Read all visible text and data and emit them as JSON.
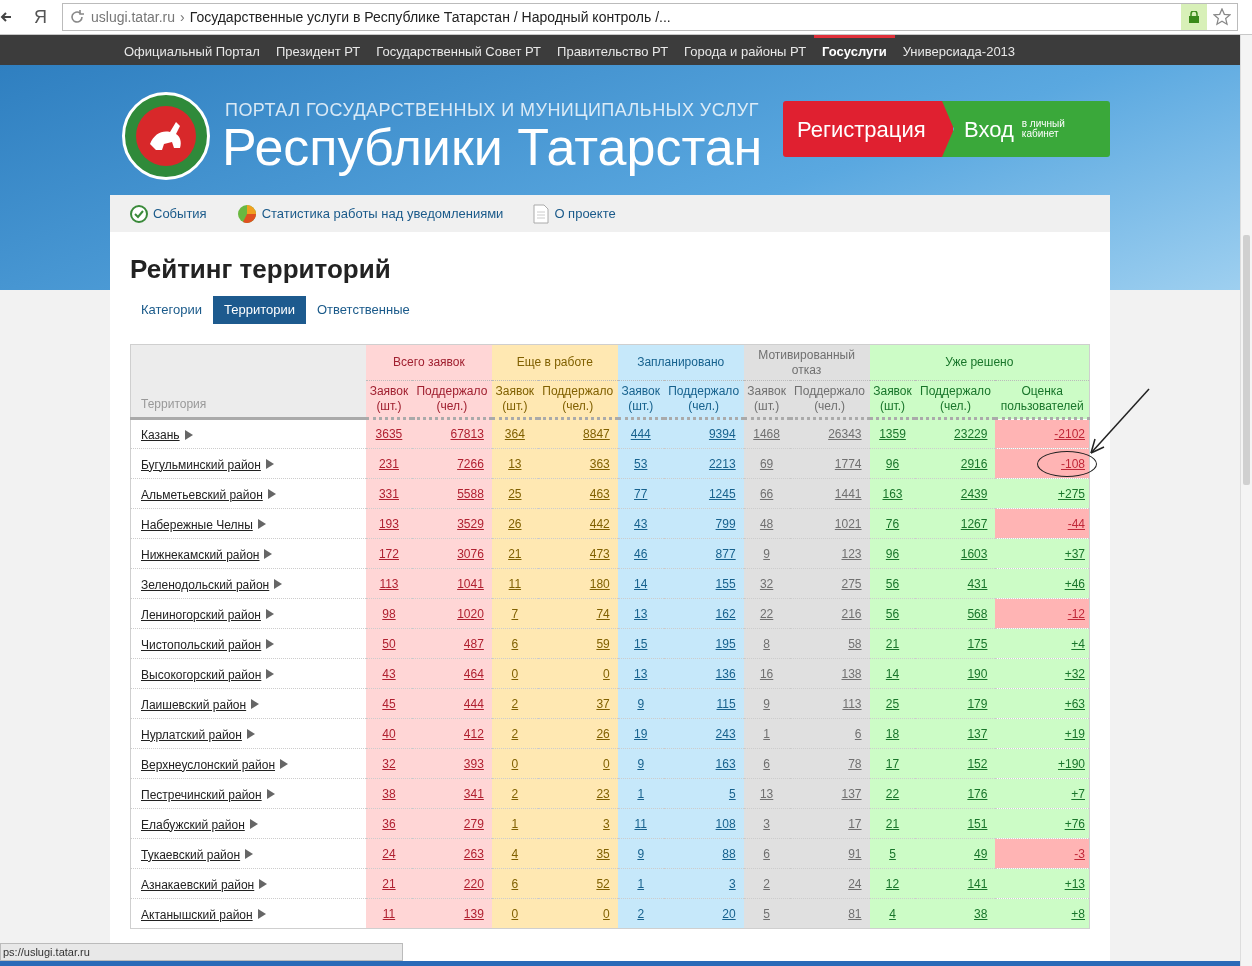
{
  "browser": {
    "domain": "uslugi.tatar.ru",
    "separator": "›",
    "title": "Государственные услуги в Республике Татарстан / Народный контроль /...",
    "yandex_glyph": "Я"
  },
  "top_nav": [
    {
      "label": "Официальный Портал",
      "selected": false
    },
    {
      "label": "Президент РТ",
      "selected": false
    },
    {
      "label": "Государственный Совет РТ",
      "selected": false
    },
    {
      "label": "Правительство РТ",
      "selected": false
    },
    {
      "label": "Города и районы РТ",
      "selected": false
    },
    {
      "label": "Госуслуги",
      "selected": true
    },
    {
      "label": "Универсиада-2013",
      "selected": false
    }
  ],
  "header": {
    "subtitle": "ПОРТАЛ ГОСУДАРСТВЕННЫХ И МУНИЦИПАЛЬНЫХ УСЛУГ",
    "title": "Республики Татарстан",
    "register_button": "Регистрация",
    "login_button": "Вход",
    "login_note": "в личный кабинет"
  },
  "section_tabs": [
    {
      "label": "События",
      "kind": "check"
    },
    {
      "label": "Статистика работы над уведомлениями",
      "kind": "pie"
    },
    {
      "label": "О проекте",
      "kind": "document"
    }
  ],
  "page_title": "Рейтинг территорий",
  "view_tabs": [
    {
      "label": "Категории",
      "selected": false
    },
    {
      "label": "Территории",
      "selected": true
    },
    {
      "label": "Ответственные",
      "selected": false
    }
  ],
  "table": {
    "territory_header": "Территория",
    "groups": [
      {
        "label": "Всего заявок",
        "color": "#ffd6d6",
        "columns": [
          "Заявок (шт.)",
          "Поддержало (чел.)"
        ]
      },
      {
        "label": "Еще в работе",
        "color": "#ffe8b2",
        "columns": [
          "Заявок (шт.)",
          "Поддержало (чел.)"
        ]
      },
      {
        "label": "Запланировано",
        "color": "#c6e8fa",
        "columns": [
          "Заявок (шт.)",
          "Поддержало (чел.)"
        ]
      },
      {
        "label": "Мотивированный отказ",
        "color": "#e0e0e0",
        "columns": [
          "Заявок (шт.)",
          "Поддержало (чел.)"
        ]
      },
      {
        "label": "Уже решено",
        "color": "#ccfcc6",
        "columns": [
          "Заявок (шт.)",
          "Поддержало (чел.)",
          "Оценка пользователей"
        ]
      }
    ],
    "rows": [
      {
        "name": "Казань",
        "values": [
          "3635",
          "67813",
          "364",
          "8847",
          "444",
          "9394",
          "1468",
          "26343",
          "1359",
          "23229"
        ],
        "rating": "-2102",
        "negative": true,
        "circled": false
      },
      {
        "name": "Бугульминский район",
        "values": [
          "231",
          "7266",
          "13",
          "363",
          "53",
          "2213",
          "69",
          "1774",
          "96",
          "2916"
        ],
        "rating": "-108",
        "negative": true,
        "circled": true
      },
      {
        "name": "Альметьевский район",
        "values": [
          "331",
          "5588",
          "25",
          "463",
          "77",
          "1245",
          "66",
          "1441",
          "163",
          "2439"
        ],
        "rating": "+275",
        "negative": false,
        "circled": false
      },
      {
        "name": "Набережные Челны",
        "values": [
          "193",
          "3529",
          "26",
          "442",
          "43",
          "799",
          "48",
          "1021",
          "76",
          "1267"
        ],
        "rating": "-44",
        "negative": true,
        "circled": false
      },
      {
        "name": "Нижнекамский район",
        "values": [
          "172",
          "3076",
          "21",
          "473",
          "46",
          "877",
          "9",
          "123",
          "96",
          "1603"
        ],
        "rating": "+37",
        "negative": false,
        "circled": false
      },
      {
        "name": "Зеленодольский район",
        "values": [
          "113",
          "1041",
          "11",
          "180",
          "14",
          "155",
          "32",
          "275",
          "56",
          "431"
        ],
        "rating": "+46",
        "negative": false,
        "circled": false
      },
      {
        "name": "Лениногорский район",
        "values": [
          "98",
          "1020",
          "7",
          "74",
          "13",
          "162",
          "22",
          "216",
          "56",
          "568"
        ],
        "rating": "-12",
        "negative": true,
        "circled": false
      },
      {
        "name": "Чистопольский район",
        "values": [
          "50",
          "487",
          "6",
          "59",
          "15",
          "195",
          "8",
          "58",
          "21",
          "175"
        ],
        "rating": "+4",
        "negative": false,
        "circled": false
      },
      {
        "name": "Высокогорский район",
        "values": [
          "43",
          "464",
          "0",
          "0",
          "13",
          "136",
          "16",
          "138",
          "14",
          "190"
        ],
        "rating": "+32",
        "negative": false,
        "circled": false
      },
      {
        "name": "Лаишевский район",
        "values": [
          "45",
          "444",
          "2",
          "37",
          "9",
          "115",
          "9",
          "113",
          "25",
          "179"
        ],
        "rating": "+63",
        "negative": false,
        "circled": false
      },
      {
        "name": "Нурлатский район",
        "values": [
          "40",
          "412",
          "2",
          "26",
          "19",
          "243",
          "1",
          "6",
          "18",
          "137"
        ],
        "rating": "+19",
        "negative": false,
        "circled": false
      },
      {
        "name": "Верхнеуслонский район",
        "values": [
          "32",
          "393",
          "0",
          "0",
          "9",
          "163",
          "6",
          "78",
          "17",
          "152"
        ],
        "rating": "+190",
        "negative": false,
        "circled": false
      },
      {
        "name": "Пестречинский район",
        "values": [
          "38",
          "341",
          "2",
          "23",
          "1",
          "5",
          "13",
          "137",
          "22",
          "176"
        ],
        "rating": "+7",
        "negative": false,
        "circled": false
      },
      {
        "name": "Елабужский район",
        "values": [
          "36",
          "279",
          "1",
          "3",
          "11",
          "108",
          "3",
          "17",
          "21",
          "151"
        ],
        "rating": "+76",
        "negative": false,
        "circled": false
      },
      {
        "name": "Тукаевский район",
        "values": [
          "24",
          "263",
          "4",
          "35",
          "9",
          "88",
          "6",
          "91",
          "5",
          "49"
        ],
        "rating": "-3",
        "negative": true,
        "circled": false
      },
      {
        "name": "Азнакаевский район",
        "values": [
          "21",
          "220",
          "6",
          "52",
          "1",
          "3",
          "2",
          "24",
          "12",
          "141"
        ],
        "rating": "+13",
        "negative": false,
        "circled": false
      },
      {
        "name": "Актанышский район",
        "values": [
          "11",
          "139",
          "0",
          "0",
          "2",
          "20",
          "5",
          "81",
          "4",
          "38"
        ],
        "rating": "+8",
        "negative": false,
        "circled": false
      }
    ]
  },
  "status_bar": "ps://uslugi.tatar.ru"
}
